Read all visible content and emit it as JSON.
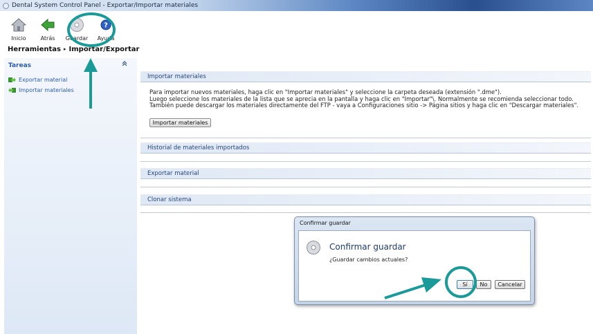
{
  "window": {
    "title": "Dental System Control Panel - Exportar/Importar materiales"
  },
  "toolbar": {
    "items": [
      {
        "label": "Inicio",
        "icon": "home-icon"
      },
      {
        "label": "Atrás",
        "icon": "back-arrow-icon"
      },
      {
        "label": "Guardar",
        "icon": "save-disc-icon"
      },
      {
        "label": "Ayuda",
        "icon": "help-icon"
      }
    ]
  },
  "breadcrumb": {
    "parent": "Herramientas",
    "separator": "▸",
    "current": "Importar/Exportar"
  },
  "sidebar": {
    "header": "Tareas",
    "collapse_icon": "double-chevron-up-icon",
    "items": [
      {
        "label": "Exportar material",
        "icon": "export-arrow-icon"
      },
      {
        "label": "Importar materiales",
        "icon": "import-arrow-icon"
      }
    ]
  },
  "sections": {
    "import": {
      "title": "Importar materiales",
      "lines": [
        "Para importar nuevos materiales, haga clic en \"Importar materiales\" y seleccione la carpeta deseada (extensión \".dme\").",
        "Luego seleccione los materiales de la lista que se aprecia en la pantalla y haga clic en \"Importar\"\\. Normalmente se recomienda seleccionar todo.",
        "También puede descargar los materiales directamente del FTP - vaya a Configuraciones sitio -> Página sitios y haga clic en \"Descargar materiales\"."
      ],
      "button": "Importar materiales"
    },
    "history": {
      "title": "Historial de materiales importados"
    },
    "export": {
      "title": "Exportar material"
    },
    "clone": {
      "title": "Clonar sistema"
    }
  },
  "dialog": {
    "window_title": "Confirmar guardar",
    "heading": "Confirmar guardar",
    "message": "¿Guardar cambios actuales?",
    "buttons": {
      "yes": "Sí",
      "no": "No",
      "cancel": "Cancelar"
    }
  },
  "colors": {
    "annotation": "#1a9a98",
    "link": "#2a5db0",
    "section_text": "#24467d"
  }
}
